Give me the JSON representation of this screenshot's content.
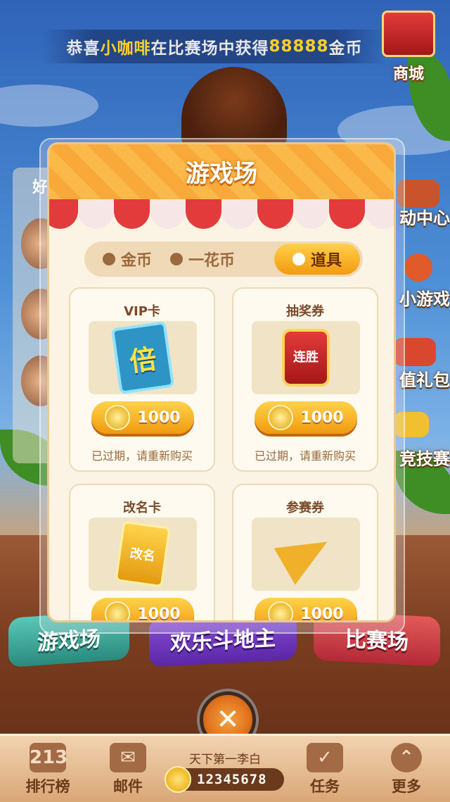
{
  "banner": {
    "prefix": "恭喜",
    "name": "小咖啡",
    "middle": "在比赛场中获得",
    "amount": "88888",
    "suffix": "金币"
  },
  "shop": {
    "label": "商城"
  },
  "left_panel": {
    "title": "好"
  },
  "side_items": [
    "动中心",
    "小游戏",
    "值礼包",
    "竞技赛"
  ],
  "modes": {
    "left": "游戏场",
    "center": "欢乐斗地主",
    "right": "比赛场"
  },
  "dialog": {
    "title": "游戏场",
    "tabs": [
      {
        "label": "金币"
      },
      {
        "label": "一花币"
      },
      {
        "label": "道具",
        "active": true
      }
    ],
    "items": [
      {
        "name": "VIP卡",
        "icon": "倍",
        "price": "1000",
        "status": "已过期，请重新购买"
      },
      {
        "name": "抽奖券",
        "icon": "连胜",
        "price": "1000",
        "status": "已过期，请重新购买"
      },
      {
        "name": "改名卡",
        "icon": "改名",
        "price": "1000"
      },
      {
        "name": "参赛券",
        "icon": "horn",
        "price": "1000"
      }
    ]
  },
  "close": {
    "glyph": "✕"
  },
  "bottom_nav": {
    "items": [
      {
        "label": "排行榜",
        "icon": "213"
      },
      {
        "label": "邮件",
        "icon": "✉"
      },
      {
        "label": "任务",
        "icon": "✓"
      },
      {
        "label": "更多",
        "icon": "⌃"
      }
    ]
  },
  "player": {
    "name": "天下第一李白",
    "coins": "12345678"
  }
}
